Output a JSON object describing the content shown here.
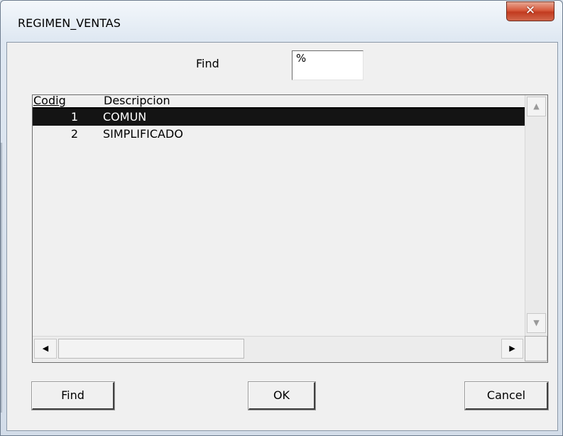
{
  "window": {
    "title": "REGIMEN_VENTAS",
    "close_glyph": "✕"
  },
  "search": {
    "label": "Find",
    "value": "%"
  },
  "table": {
    "columns": [
      "Codig",
      "Descripcion"
    ],
    "rows": [
      {
        "code": "1",
        "description": "COMUN",
        "selected": true
      },
      {
        "code": "2",
        "description": "SIMPLIFICADO",
        "selected": false
      }
    ]
  },
  "scrollbars": {
    "up_glyph": "▲",
    "down_glyph": "▼",
    "left_glyph": "◀",
    "right_glyph": "▶"
  },
  "buttons": {
    "find": "Find",
    "ok": "OK",
    "cancel": "Cancel"
  },
  "colors": {
    "selection": "#141414",
    "close_button": "#c8442a"
  }
}
